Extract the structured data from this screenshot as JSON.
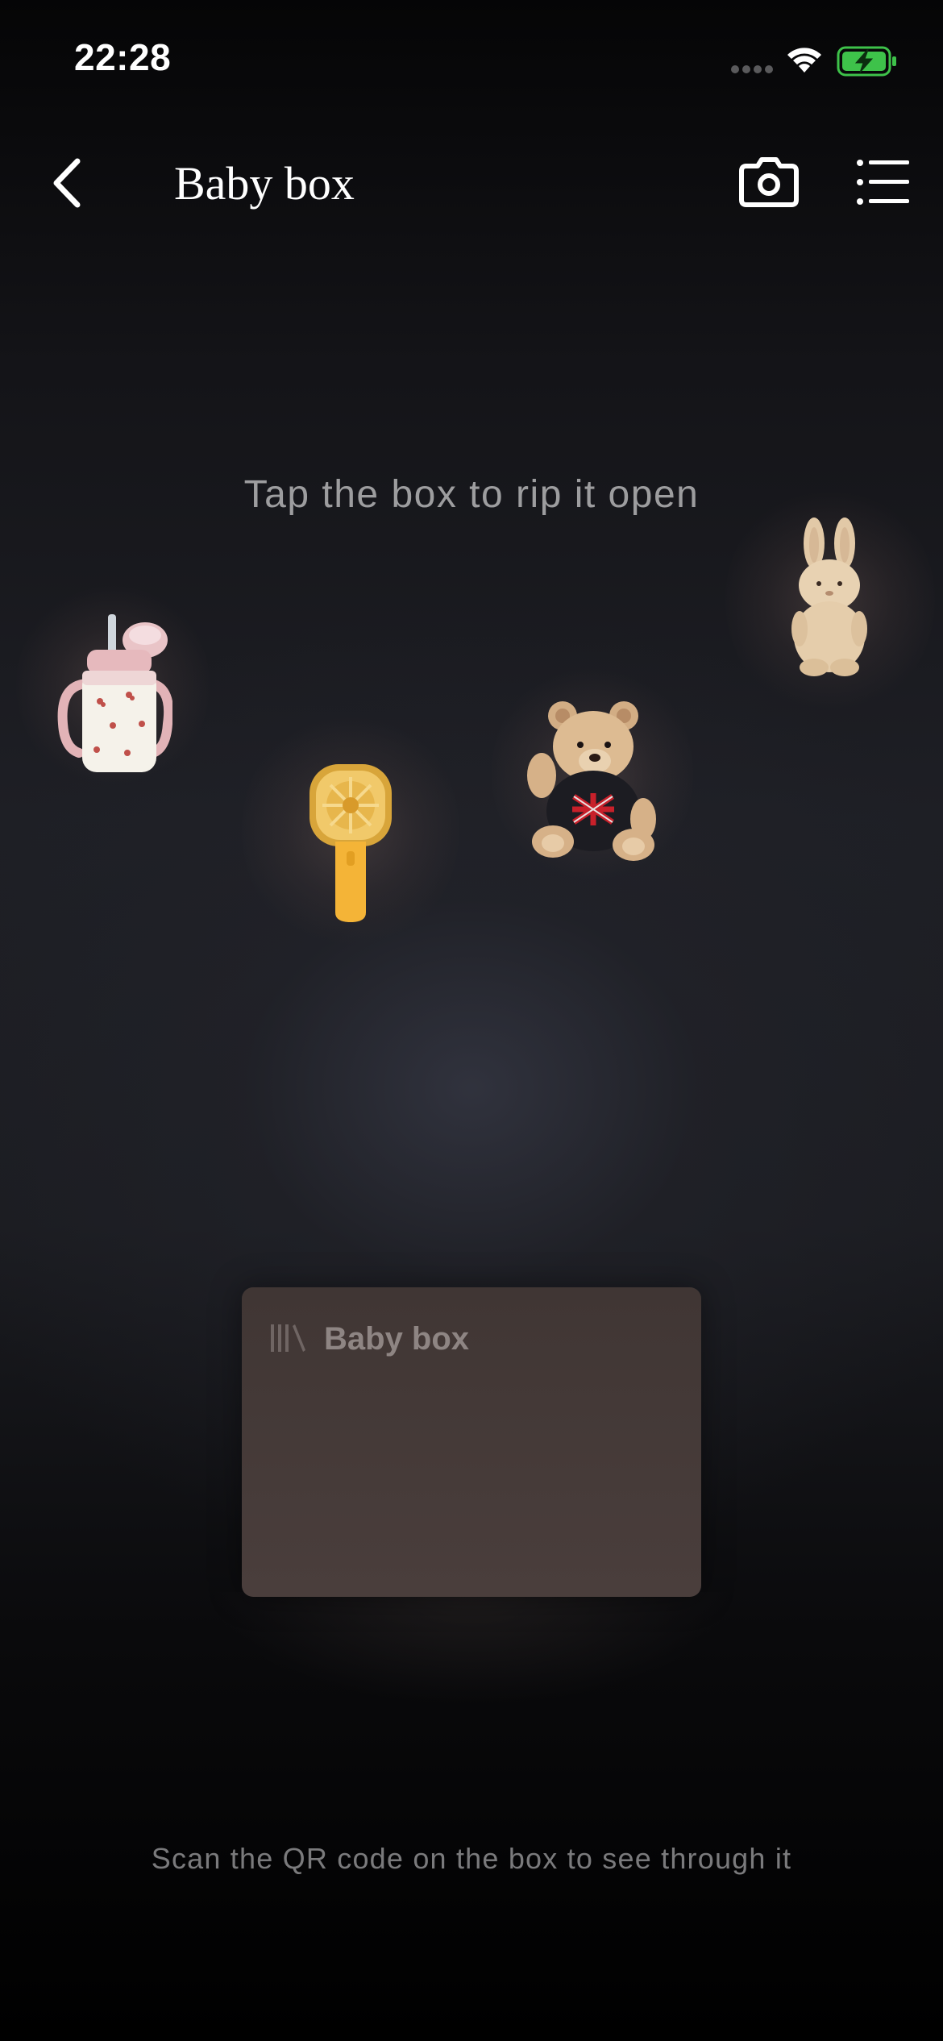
{
  "status_bar": {
    "time": "22:28",
    "icons": [
      "cellular-signal-icon",
      "wifi-icon",
      "battery-charging-icon"
    ],
    "battery_color": "#3ec24a"
  },
  "nav": {
    "title": "Baby box",
    "back_icon": "chevron-left-icon",
    "camera_icon": "camera-icon",
    "menu_icon": "list-icon"
  },
  "main": {
    "hint": "Tap the box to rip it open",
    "items": [
      {
        "name": "sippy-cup",
        "icon": "sippy-cup-icon"
      },
      {
        "name": "handheld-fan",
        "icon": "handheld-fan-icon"
      },
      {
        "name": "teddy-bear",
        "icon": "teddy-bear-icon"
      },
      {
        "name": "bunny-plush",
        "icon": "bunny-plush-icon"
      }
    ]
  },
  "box": {
    "label": "Baby box",
    "icon": "library-icon",
    "color": "#463b39"
  },
  "footer": {
    "text": "Scan the QR code on the box to see through it"
  }
}
